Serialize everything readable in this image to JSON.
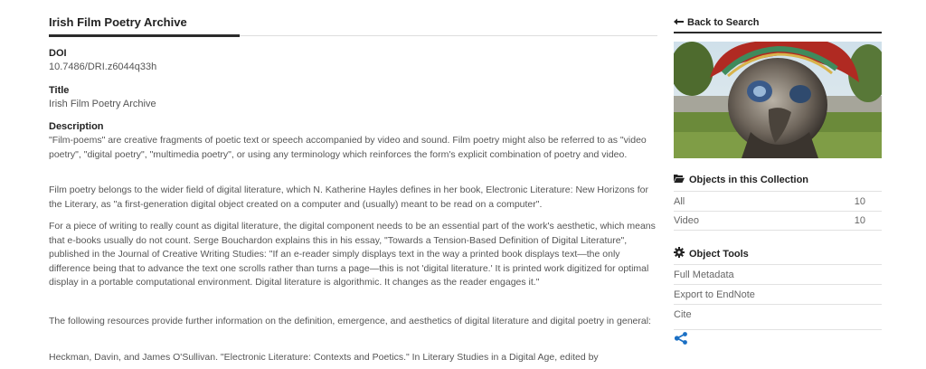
{
  "main": {
    "title": "Irish Film Poetry Archive",
    "doi_label": "DOI",
    "doi_value": "10.7486/DRI.z6044q33h",
    "title_label": "Title",
    "title_value": "Irish Film Poetry Archive",
    "description_label": "Description",
    "paragraphs": [
      "\"Film-poems\" are creative fragments of poetic text or speech accompanied by video and sound. Film poetry might also be referred to as \"video poetry\", \"digital poetry\", \"multimedia poetry\", or using any terminology which reinforces the form's explicit combination of poetry and video.",
      "Film poetry belongs to the wider field of digital literature, which N. Katherine Hayles defines in her book, Electronic Literature: New Horizons for the Literary, as \"a first-generation digital object created on a computer and (usually) meant to be read on a computer\".",
      "For a piece of writing to really count as digital literature, the digital component needs to be an essential part of the work's aesthetic, which means that e-books usually do not count. Serge Bouchardon explains this in his essay, \"Towards a Tension-Based Definition of Digital Literature\", published in the Journal of Creative Writing Studies: \"If an e-reader simply displays text in the way a printed book displays text—the only difference being that to advance the text one scrolls rather than turns a page—this is not 'digital literature.' It is printed work digitized for optimal display in a portable computational environment. Digital literature is algorithmic. It changes as the reader engages it.\"",
      "The following resources provide further information on the definition, emergence, and aesthetics of digital literature and digital poetry in general:",
      "Heckman, Davin, and James O'Sullivan. \"Electronic Literature: Contexts and Poetics.\" In Literary Studies in a Digital Age, edited by"
    ]
  },
  "sidebar": {
    "back_label": "Back to Search",
    "objects_heading": "Objects in this Collection",
    "objects": [
      {
        "label": "All",
        "count": "10"
      },
      {
        "label": "Video",
        "count": "10"
      }
    ],
    "tools_heading": "Object Tools",
    "tools": [
      "Full Metadata",
      "Export to EndNote",
      "Cite"
    ]
  },
  "icons": {
    "back": "arrow-left-icon",
    "folder": "folder-open-icon",
    "cog": "cog-icon",
    "share": "share-icon"
  },
  "colors": {
    "accent": "#1a6fc4",
    "heading": "#222222",
    "text": "#555555"
  }
}
